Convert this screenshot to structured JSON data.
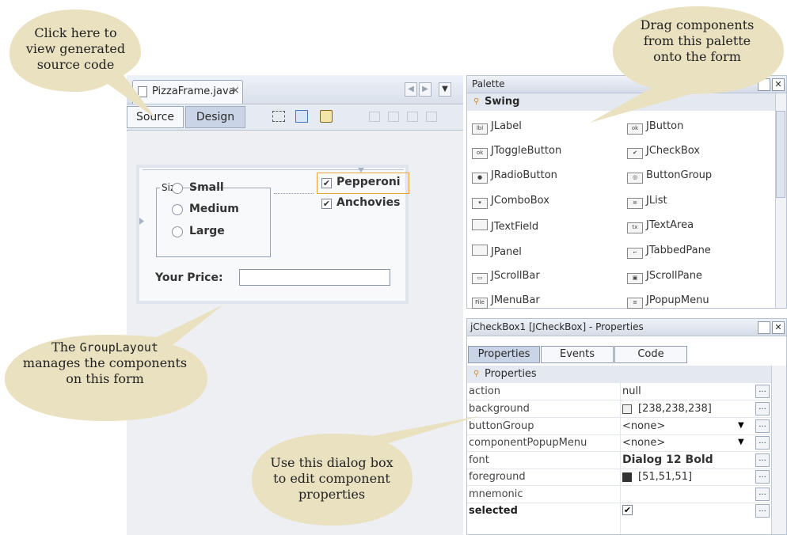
{
  "callouts": {
    "source": [
      "Click here to",
      "view generated",
      "source code"
    ],
    "palette": [
      "Drag components",
      "from this palette",
      "onto the form"
    ],
    "layout_line1_pre": "The ",
    "layout_line1_code": "GroupLayout",
    "layout_line2": "manages the components",
    "layout_line3": "on this form",
    "props": [
      "Use this dialog box",
      "to edit component",
      "properties"
    ]
  },
  "editor": {
    "file_tab": "PizzaFrame.java",
    "close": "×",
    "source_label": "Source",
    "design_label": "Design"
  },
  "form": {
    "size_title": "Size",
    "options": [
      "Small",
      "Medium",
      "Large"
    ],
    "checks": [
      "Pepperoni",
      "Anchovies"
    ],
    "price_label": "Your Price:"
  },
  "palette": {
    "title": "Palette",
    "category": "Swing",
    "items": [
      {
        "label": "JLabel",
        "icon": "label-icon"
      },
      {
        "label": "JButton",
        "icon": "button-icon"
      },
      {
        "label": "JToggleButton",
        "icon": "togglebutton-icon"
      },
      {
        "label": "JCheckBox",
        "icon": "checkbox-icon"
      },
      {
        "label": "JRadioButton",
        "icon": "radiobutton-icon"
      },
      {
        "label": "ButtonGroup",
        "icon": "buttongroup-icon"
      },
      {
        "label": "JComboBox",
        "icon": "combobox-icon"
      },
      {
        "label": "JList",
        "icon": "list-icon"
      },
      {
        "label": "JTextField",
        "icon": "textfield-icon"
      },
      {
        "label": "JTextArea",
        "icon": "textarea-icon"
      },
      {
        "label": "JPanel",
        "icon": "panel-icon"
      },
      {
        "label": "JTabbedPane",
        "icon": "tabbedpane-icon"
      },
      {
        "label": "JScrollBar",
        "icon": "scrollbar-icon"
      },
      {
        "label": "JScrollPane",
        "icon": "scrollpane-icon"
      },
      {
        "label": "JMenuBar",
        "icon": "menubar-icon"
      },
      {
        "label": "JPopupMenu",
        "icon": "popupmenu-icon"
      }
    ]
  },
  "properties": {
    "title": "jCheckBox1 [JCheckBox] - Properties",
    "tabs": [
      "Properties",
      "Events",
      "Code"
    ],
    "section": "Properties",
    "rows": [
      {
        "name": "action",
        "value": "null"
      },
      {
        "name": "background",
        "value": "[238,238,238]"
      },
      {
        "name": "buttonGroup",
        "value": "<none>"
      },
      {
        "name": "componentPopupMenu",
        "value": "<none>"
      },
      {
        "name": "font",
        "value": "Dialog 12 Bold"
      },
      {
        "name": "foreground",
        "value": "[51,51,51]"
      },
      {
        "name": "mnemonic",
        "value": ""
      },
      {
        "name": "selected",
        "value": "✔"
      }
    ]
  },
  "colors": {
    "callout": "#e9e1bf",
    "accent": "#e8a33a",
    "panel_header": "#d6dde8"
  }
}
